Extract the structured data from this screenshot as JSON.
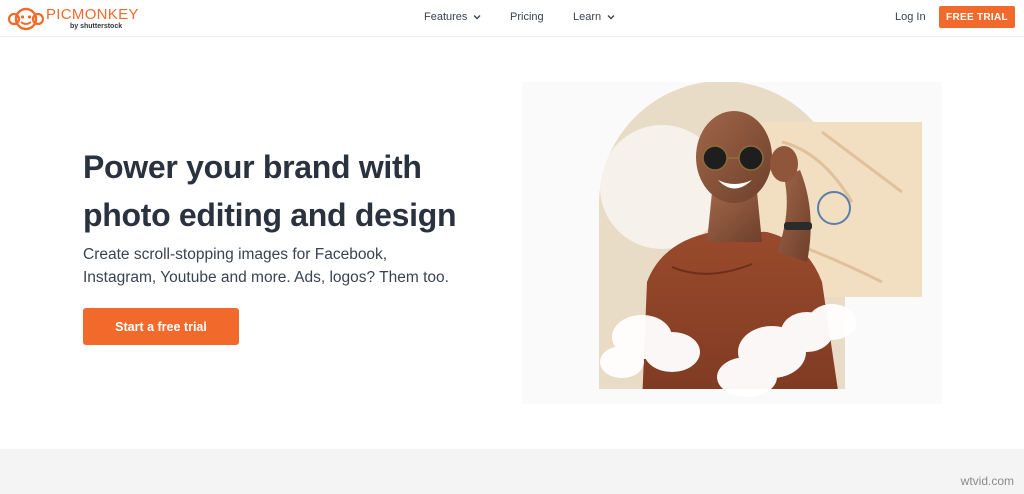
{
  "brand": {
    "name": "PICMONKEY",
    "byline": "by shutterstock",
    "color": "#f26a2b"
  },
  "nav": {
    "items": [
      {
        "label": "Features",
        "has_dropdown": true,
        "icon": "chevron-down-icon"
      },
      {
        "label": "Pricing",
        "has_dropdown": false
      },
      {
        "label": "Learn",
        "has_dropdown": true,
        "icon": "chevron-down-icon"
      }
    ],
    "login_label": "Log In",
    "trial_label": "FREE TRIAL"
  },
  "hero": {
    "title_line1": "Power your brand with",
    "title_line2": "photo editing and design",
    "subtitle_line1": "Create scroll-stopping images for Facebook,",
    "subtitle_line2": "Instagram, Youtube and more. Ads, logos? Them too.",
    "cta_label": "Start a free trial"
  },
  "watermark": "wtvid.com"
}
